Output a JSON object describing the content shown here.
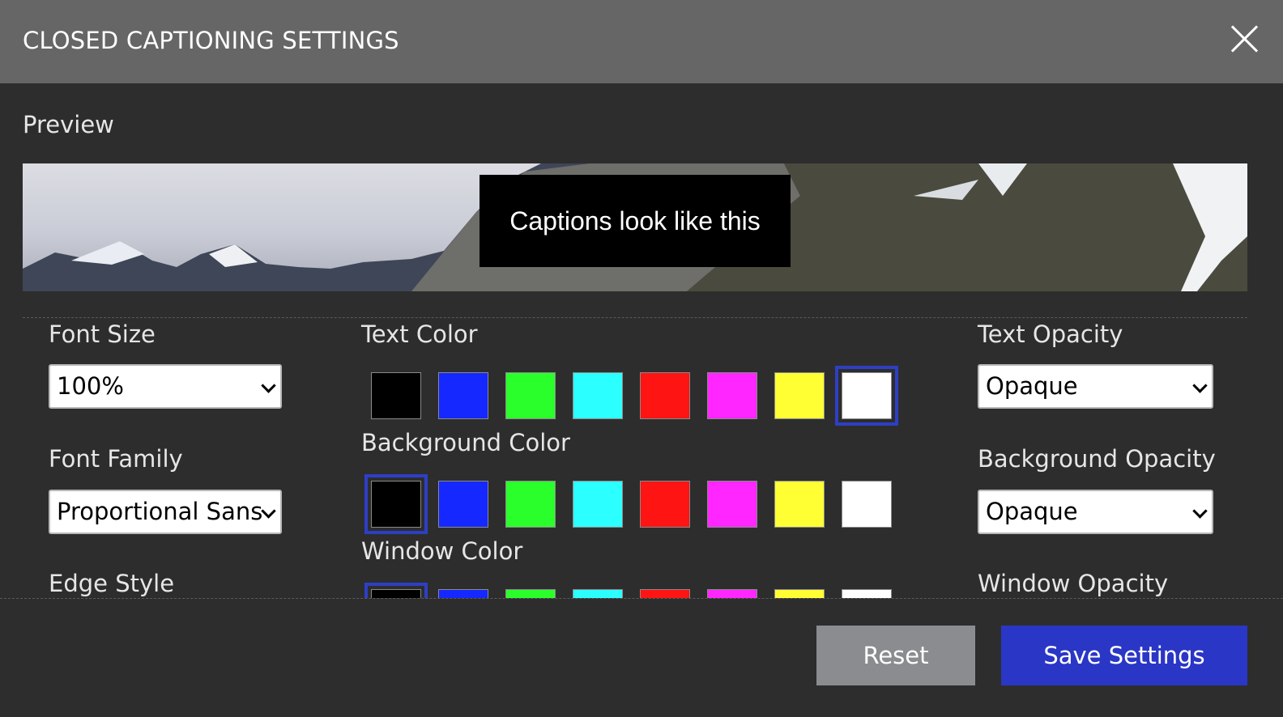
{
  "header": {
    "title": "CLOSED CAPTIONING SETTINGS"
  },
  "preview": {
    "label": "Preview",
    "caption_text": "Captions look like this"
  },
  "left": {
    "font_size": {
      "label": "Font Size",
      "value": "100%"
    },
    "font_family": {
      "label": "Font Family",
      "value": "Proportional Sans"
    },
    "edge_style": {
      "label": "Edge Style"
    }
  },
  "middle": {
    "text_color": {
      "label": "Text Color",
      "selected": "white"
    },
    "background_color": {
      "label": "Background Color",
      "selected": "black"
    },
    "window_color": {
      "label": "Window Color",
      "selected": "black"
    }
  },
  "right": {
    "text_opacity": {
      "label": "Text Opacity",
      "value": "Opaque"
    },
    "background_opacity": {
      "label": "Background Opacity",
      "value": "Opaque"
    },
    "window_opacity": {
      "label": "Window Opacity"
    }
  },
  "swatch_colors": [
    "#000000",
    "#1428ff",
    "#2bff2b",
    "#2bffff",
    "#ff1414",
    "#ff26ff",
    "#ffff33",
    "#ffffff"
  ],
  "accent": "#2e3fc4",
  "buttons": {
    "reset": "Reset",
    "save": "Save Settings"
  }
}
